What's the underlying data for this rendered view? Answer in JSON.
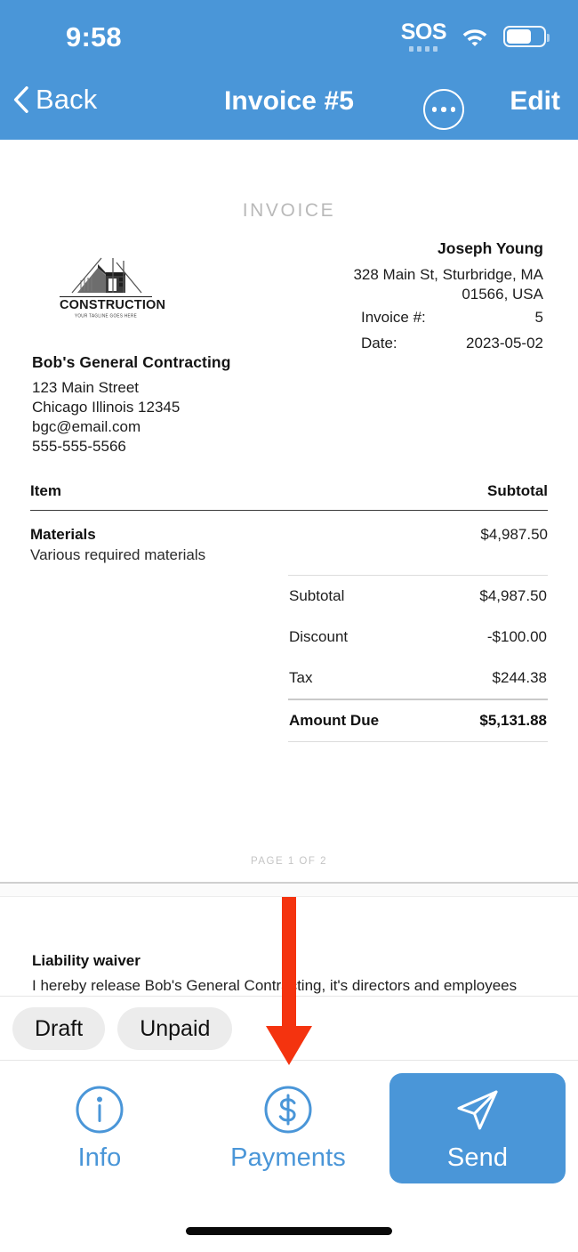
{
  "status_bar": {
    "time": "9:58",
    "sos_label": "SOS",
    "wifi_icon": "wifi-icon",
    "battery_icon": "battery-icon"
  },
  "nav": {
    "back_label": "Back",
    "back_icon": "chevron-left-icon",
    "title": "Invoice #5",
    "more_icon": "ellipsis-circle-icon",
    "edit_label": "Edit"
  },
  "invoice": {
    "kicker": "INVOICE",
    "logo": {
      "wordmark": "CONSTRUCTION",
      "tagline": "YOUR TAGLINE GOES HERE",
      "icon": "construction-house-logo-icon"
    },
    "payee": {
      "name": "Joseph Young",
      "address_line1": "328 Main St, Sturbridge, MA",
      "address_line2": "01566, USA"
    },
    "meta": [
      {
        "key": "Invoice #:",
        "value": "5"
      },
      {
        "key": "Date:",
        "value": "2023-05-02"
      }
    ],
    "bill_from": {
      "name": "Bob's General Contracting",
      "lines": [
        "123 Main Street",
        "Chicago Illinois 12345",
        "bgc@email.com",
        "555-555-5566"
      ]
    },
    "table": {
      "col_item": "Item",
      "col_subtotal": "Subtotal",
      "rows": [
        {
          "name": "Materials",
          "description": "Various required materials",
          "amount": "$4,987.50"
        }
      ]
    },
    "totals": [
      {
        "label": "Subtotal",
        "value": "$4,987.50",
        "bold": false
      },
      {
        "label": "Discount",
        "value": "-$100.00",
        "bold": false
      },
      {
        "label": "Tax",
        "value": "$244.38",
        "bold": false
      },
      {
        "label": "Amount Due",
        "value": "$5,131.88",
        "bold": true
      }
    ],
    "page_footer": "PAGE 1 OF 2",
    "page2": {
      "waiver_title": "Liability waiver",
      "waiver_body": "I hereby release Bob's General Contracting, it's directors and employees from all manner of"
    }
  },
  "chips": [
    {
      "label": "Draft"
    },
    {
      "label": "Unpaid"
    }
  ],
  "toolbar": {
    "info_label": "Info",
    "info_icon": "info-circle-icon",
    "payments_label": "Payments",
    "payments_icon": "dollar-circle-icon",
    "send_label": "Send",
    "send_icon": "paper-plane-icon"
  },
  "annotation": {
    "arrow_icon": "down-arrow-annotation",
    "arrow_color": "#f4330f",
    "points_to": "Payments"
  },
  "colors": {
    "accent_blue": "#4a96d8",
    "chip_bg": "#ececec",
    "annotation_red": "#f4330f"
  }
}
